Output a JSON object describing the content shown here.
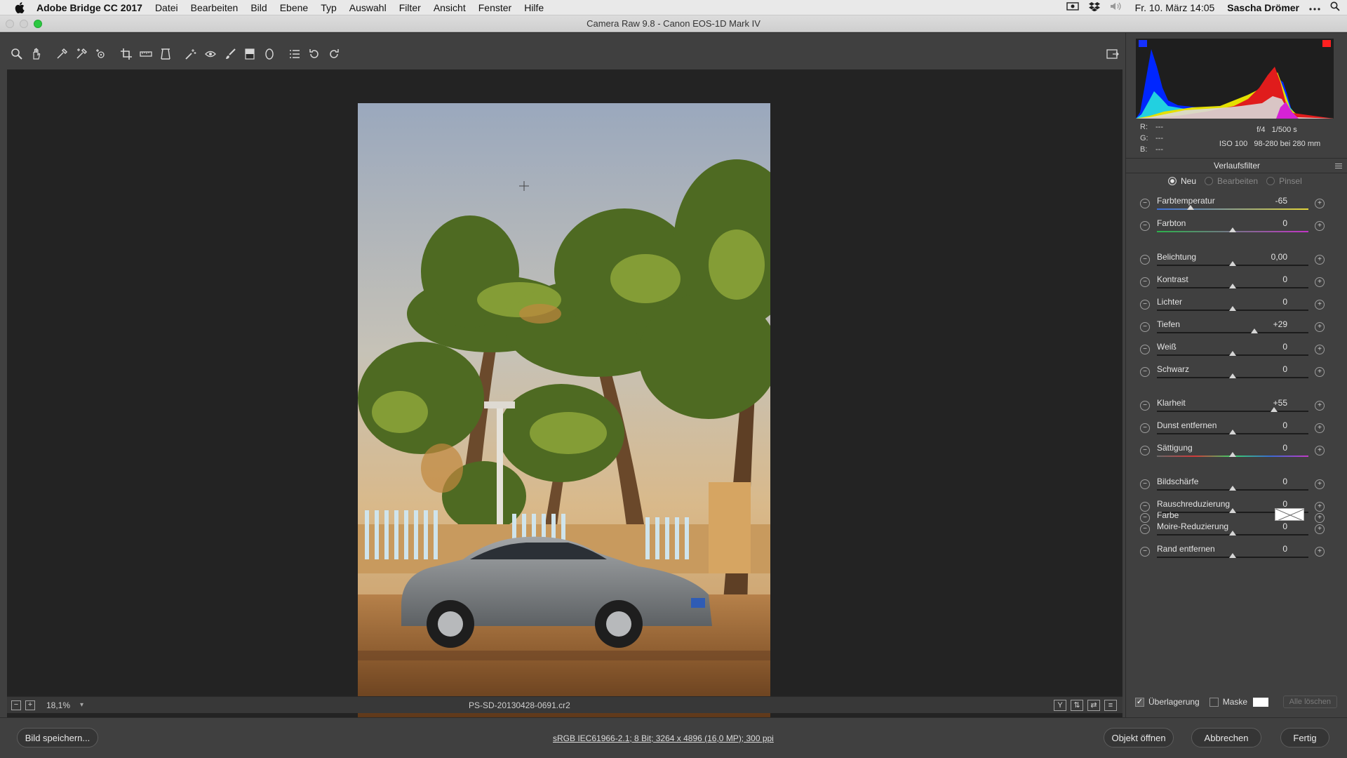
{
  "menubar": {
    "app": "Adobe Bridge CC 2017",
    "items": [
      "Datei",
      "Bearbeiten",
      "Bild",
      "Ebene",
      "Typ",
      "Auswahl",
      "Filter",
      "Ansicht",
      "Fenster",
      "Hilfe"
    ],
    "clock": "Fr. 10. März  14:05",
    "user": "Sascha Drömer"
  },
  "window": {
    "title": "Camera Raw 9.8  -  Canon EOS-1D Mark IV"
  },
  "toolbar": {
    "tools": [
      "zoom-tool-icon",
      "hand-tool-icon",
      "white-balance-tool-icon",
      "color-sampler-tool-icon",
      "target-adjustment-tool-icon",
      "crop-tool-icon",
      "straighten-tool-icon",
      "transform-tool-icon",
      "spot-removal-tool-icon",
      "red-eye-tool-icon",
      "adjustment-brush-icon",
      "graduated-filter-icon",
      "radial-filter-icon",
      "preferences-icon",
      "rotate-ccw-icon",
      "rotate-cw-icon"
    ]
  },
  "preview": {
    "zoom": "18,1%",
    "filename": "PS-SD-20130428-0691.cr2"
  },
  "rgb": {
    "r_label": "R:",
    "g_label": "G:",
    "b_label": "B:",
    "r": "---",
    "g": "---",
    "b": "---"
  },
  "camera": {
    "aperture": "f/4",
    "shutter": "1/500 s",
    "iso": "ISO 100",
    "lens": "98-280 bei 280 mm"
  },
  "panel": {
    "title": "Verlaufsfilter",
    "modes": [
      "Neu",
      "Bearbeiten",
      "Pinsel"
    ],
    "active_mode": "Neu",
    "sliders": [
      {
        "label": "Farbtemperatur",
        "value": "-65",
        "position": 0.22
      },
      {
        "label": "Farbton",
        "value": "0",
        "position": 0.5
      },
      {
        "label": "Belichtung",
        "value": "0,00",
        "position": 0.5
      },
      {
        "label": "Kontrast",
        "value": "0",
        "position": 0.5
      },
      {
        "label": "Lichter",
        "value": "0",
        "position": 0.5
      },
      {
        "label": "Tiefen",
        "value": "+29",
        "position": 0.645
      },
      {
        "label": "Weiß",
        "value": "0",
        "position": 0.5
      },
      {
        "label": "Schwarz",
        "value": "0",
        "position": 0.5
      },
      {
        "label": "Klarheit",
        "value": "+55",
        "position": 0.775
      },
      {
        "label": "Dunst entfernen",
        "value": "0",
        "position": 0.5
      },
      {
        "label": "Sättigung",
        "value": "0",
        "position": 0.5
      },
      {
        "label": "Bildschärfe",
        "value": "0",
        "position": 0.5
      },
      {
        "label": "Rauschreduzierung",
        "value": "0",
        "position": 0.5
      },
      {
        "label": "Moire-Reduzierung",
        "value": "0",
        "position": 0.5
      },
      {
        "label": "Rand entfernen",
        "value": "0",
        "position": 0.5
      }
    ],
    "color_label": "Farbe"
  },
  "overlay": {
    "overlay_label": "Überlagerung",
    "overlay_checked": true,
    "mask_label": "Maske",
    "mask_checked": false,
    "clear_all": "Alle löschen"
  },
  "footer": {
    "save": "Bild speichern...",
    "info": "sRGB IEC61966-2.1; 8 Bit; 3264 x 4896 (16,0 MP); 300 ppi",
    "open": "Objekt öffnen",
    "cancel": "Abbrechen",
    "done": "Fertig"
  },
  "colors": {
    "accent_green": "#2bc840",
    "panel_bg": "#404040",
    "preview_bg": "#232323"
  }
}
